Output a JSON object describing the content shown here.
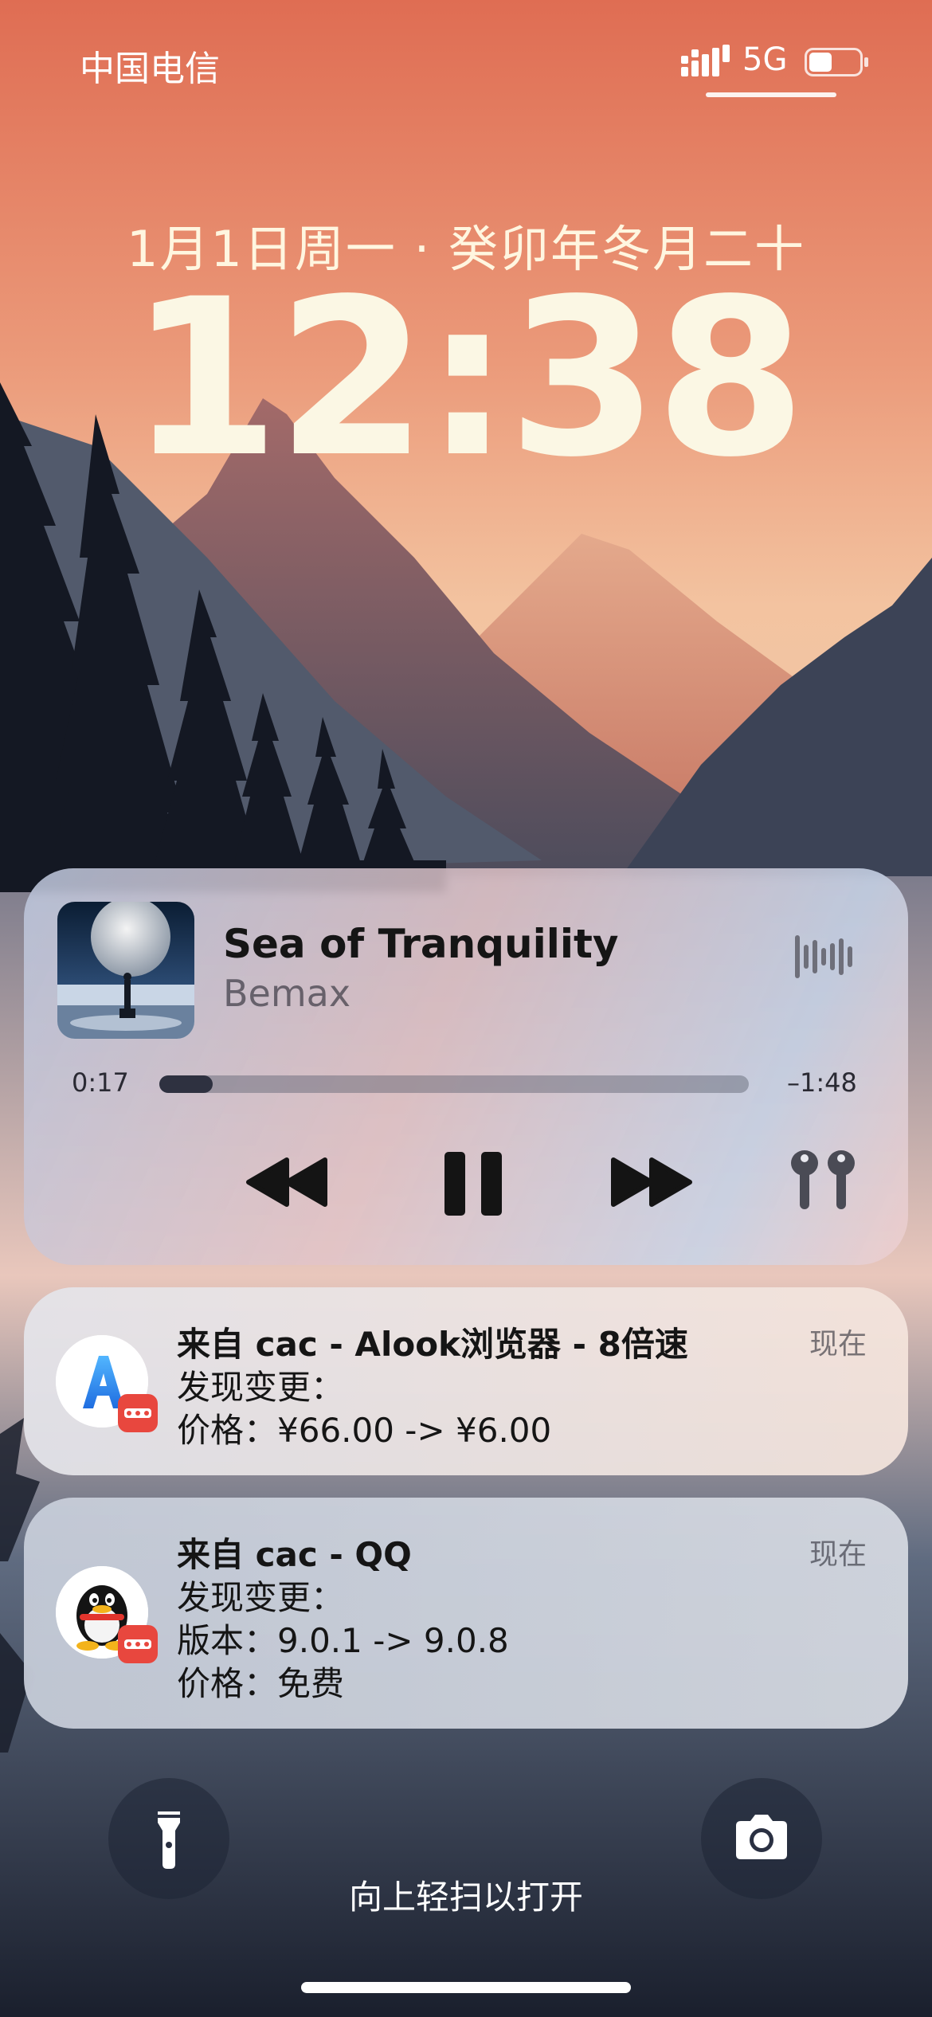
{
  "status_bar": {
    "carrier": "中国电信",
    "network": "5G",
    "signal_icon": "signal-bars-icon",
    "battery_icon": "battery-icon"
  },
  "lock": {
    "date": "1月1日周一 · 癸卯年冬月二十",
    "time": "12:38"
  },
  "media": {
    "title": "Sea of Tranquility",
    "artist": "Bemax",
    "elapsed": "0:17",
    "remaining": "–1:48",
    "progress_fraction": 0.09,
    "icons": [
      "waveform-icon",
      "rewind-icon",
      "pause-icon",
      "fast-forward-icon",
      "airpods-icon"
    ]
  },
  "notifications": [
    {
      "app_icon": "alook-browser-app-icon",
      "title": "来自 cac - Alook浏览器 - 8倍速",
      "time": "现在",
      "lines": [
        "发现变更：",
        "价格：¥66.00 -> ¥6.00"
      ]
    },
    {
      "app_icon": "qq-app-icon",
      "title": "来自 cac - QQ",
      "time": "现在",
      "lines": [
        "发现变更：",
        "版本：9.0.1 -> 9.0.8",
        "价格：免费"
      ]
    }
  ],
  "bottom": {
    "swipe_hint": "向上轻扫以打开",
    "flashlight_icon": "flashlight-icon",
    "camera_icon": "camera-icon"
  },
  "colors": {
    "sky_top": "#e2735a",
    "sky_mid": "#f2b394",
    "clock_text": "#fbf7e4",
    "badge_red": "#e8473e"
  }
}
